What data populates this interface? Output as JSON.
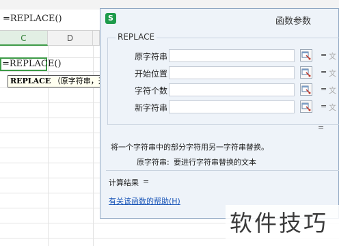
{
  "spreadsheet": {
    "formula": "=REPLACE()",
    "columns": [
      "C",
      "D"
    ],
    "active_cell_text": "=REPLACE()",
    "tooltip": {
      "function_name": "REPLACE",
      "args_preview": "（原字符串，开"
    }
  },
  "dialog": {
    "app_logo": "S",
    "title": "函数参数",
    "function_name": "REPLACE",
    "arguments": [
      {
        "label": "原字符串",
        "value": "",
        "result": "文"
      },
      {
        "label": "开始位置",
        "value": "",
        "result": "文"
      },
      {
        "label": "字符个数",
        "value": "",
        "result": "文"
      },
      {
        "label": "新字符串",
        "value": "",
        "result": "文"
      }
    ],
    "equals_sign": "=",
    "function_result": "",
    "description": "将一个字符串中的部分字符用另一字符串替换。",
    "param_desc_name": "原字符串:",
    "param_desc_text": "要进行字符串替换的文本",
    "calc_result_label": "计算结果",
    "calc_result_eq": "=",
    "help_link": "有关该函数的帮助(H)"
  },
  "watermark": "软件技巧",
  "colors": {
    "accent_green": "#3c9a46",
    "dialog_bg": "#eef3f9",
    "link_blue": "#1a56b8"
  }
}
